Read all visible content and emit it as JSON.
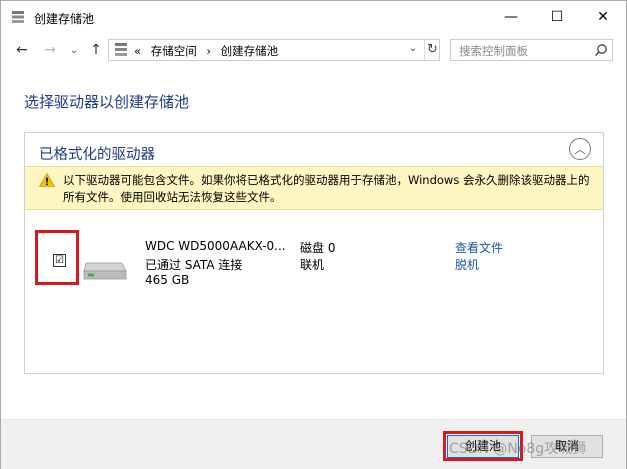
{
  "window": {
    "title": "创建存储池",
    "controls": {
      "minimize": "—",
      "maximize": "☐",
      "close": "✕"
    }
  },
  "navbar": {
    "back": "←",
    "forward": "→",
    "recent": "⌄",
    "up": "↑",
    "breadcrumbs": [
      "«",
      "存储空间",
      "›",
      "创建存储池"
    ],
    "dropdown": "⌄",
    "refresh": "↻",
    "search_placeholder": "搜索控制面板"
  },
  "main": {
    "heading": "选择驱动器以创建存储池",
    "panel": {
      "title": "已格式化的驱动器",
      "collapse": "︿",
      "warning": "以下驱动器可能包含文件。如果你将已格式化的驱动器用于存储池，Windows 会永久删除该驱动器上的所有文件。使用回收站无法恢复这些文件。",
      "drive": {
        "checked_mark": "☑",
        "name": "WDC WD5000AAKX-0...",
        "connection": "已通过 SATA 连接",
        "size": "465 GB",
        "disk_number": "磁盘 0",
        "status": "联机",
        "view_files": "查看文件",
        "offline": "脱机"
      }
    }
  },
  "footer": {
    "create_label": "创建池",
    "cancel_label": "取消",
    "watermark": "CSDN @No8g攻城狮"
  },
  "colors": {
    "heading": "#1e3a8a",
    "link": "#1a57a8",
    "warning_bg": "#fdf6c2",
    "highlight": "#d71920"
  }
}
